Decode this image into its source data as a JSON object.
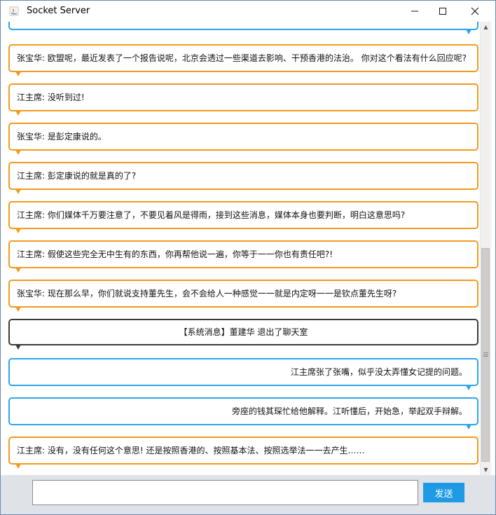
{
  "window": {
    "title": "Socket Server",
    "controls": {
      "minimize": "minimize",
      "maximize": "maximize",
      "close": "close"
    }
  },
  "chat": {
    "messages": [
      {
        "type": "left",
        "text": "张宝华: 欧盟呢，最近发表了一个报告说呢，北京会透过一些渠道去影响、干预香港的法治。 你对这个看法有什么回应呢?"
      },
      {
        "type": "left",
        "text": "江主席: 没听到过!"
      },
      {
        "type": "left",
        "text": "张宝华: 是彭定康说的。"
      },
      {
        "type": "left",
        "text": "江主席: 彭定康说的就是真的了?"
      },
      {
        "type": "left",
        "text": "江主席: 你们媒体千万要注意了，不要见着风是得雨，接到这些消息，媒体本身也要判断，明白这意思吗?"
      },
      {
        "type": "left",
        "text": "江主席: 假使这些完全无中生有的东西，你再帮他说一遍，你等于一一你也有责任吧?!"
      },
      {
        "type": "left",
        "text": "张宝华: 现在那么早，你们就说支持董先生，会不会给人一种感觉一一就是内定呀一一是钦点董先生呀?"
      },
      {
        "type": "system",
        "text": "【系统消息】董建华 退出了聊天室"
      },
      {
        "type": "right",
        "text": "江主席张了张嘴，似乎没太弄懂女记提的问题。"
      },
      {
        "type": "right",
        "text": "旁座的钱其琛忙给他解释。江听懂后，开始急，举起双手辩解。"
      },
      {
        "type": "left",
        "text": "江主席: 没有，没有任何这个意思! 还是按照香港的、按照基本法、按照选举法一一去产生……"
      }
    ]
  },
  "input": {
    "value": "",
    "placeholder": ""
  },
  "send_button": {
    "label": "发送"
  },
  "colors": {
    "left_border": "#f29a1f",
    "right_border": "#2aa7ea",
    "system_border": "#3c3c3c",
    "send_bg": "#1f9be6"
  }
}
